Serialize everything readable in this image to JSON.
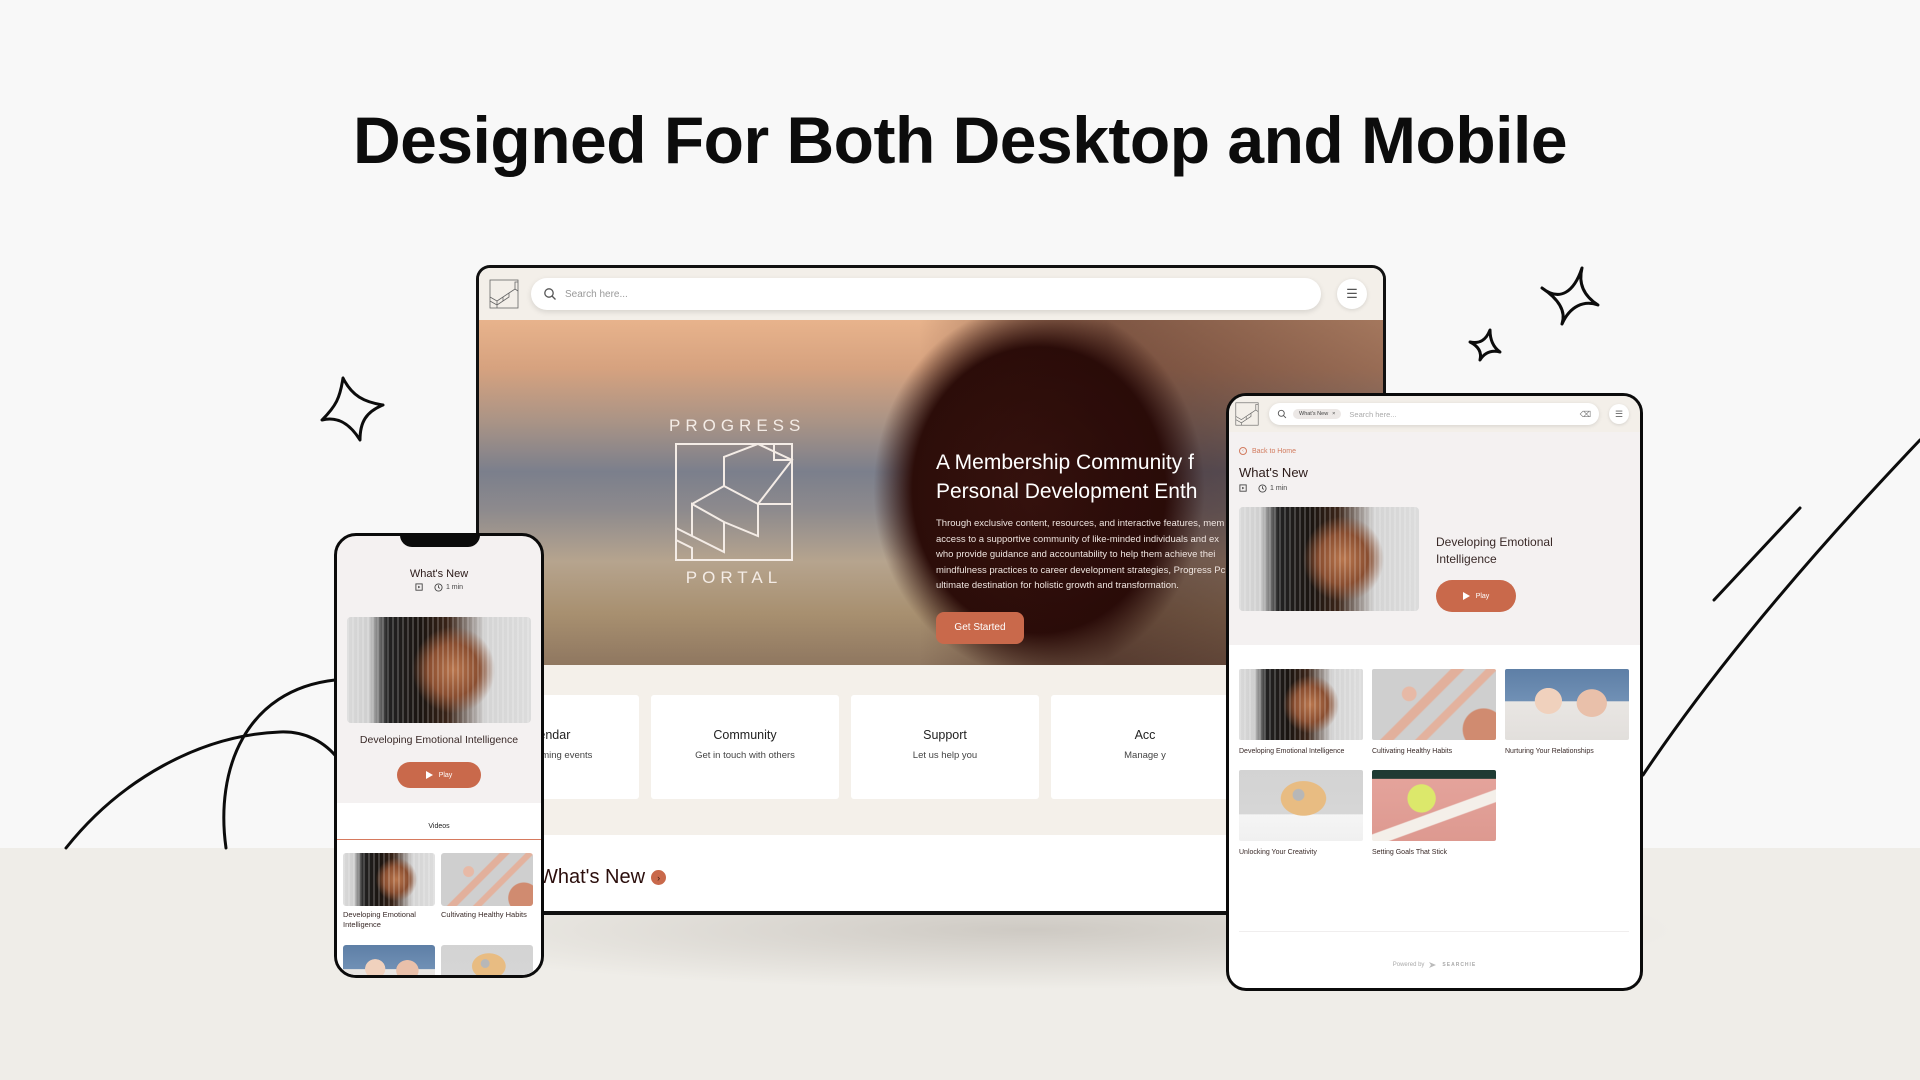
{
  "page": {
    "title": "Designed For Both Desktop and Mobile"
  },
  "colors": {
    "accent": "#c9694b",
    "heading_dark": "#2b0e0c",
    "header_bg": "#f3efe9",
    "background": "#f8f8f8",
    "floor": "#efede8"
  },
  "desktop": {
    "logo_icon": "stairs-logo-icon",
    "search": {
      "placeholder": "Search here...",
      "icon": "search-icon"
    },
    "menu_icon": "hamburger-menu-icon",
    "hero": {
      "brand_top": "PROGRESS",
      "brand_bottom": "PORTAL",
      "title": "A Membership Community f\nPersonal Development Enth",
      "body": "Through exclusive content, resources, and interactive features, mem\naccess to a supportive community of like-minded individuals and ex\nwho provide guidance and accountability to help them achieve thei\nmindfulness practices to career development strategies, Progress Pc\nultimate destination for holistic growth and transformation.",
      "cta": "Get Started"
    },
    "cards": [
      {
        "title": "Calendar",
        "subtitle": "View upcoming events"
      },
      {
        "title": "Community",
        "subtitle": "Get in touch with others"
      },
      {
        "title": "Support",
        "subtitle": "Let us help you"
      },
      {
        "title": "Acc",
        "subtitle": "Manage y"
      }
    ],
    "whats_new": "What's New",
    "whats_new_chevron": "›"
  },
  "phone": {
    "title": "What's New",
    "duration": "1 min",
    "feature_title": "Developing Emotional Intelligence",
    "play": "Play",
    "tab": "Videos",
    "items": [
      {
        "title": "Developing Emotional Intelligence"
      },
      {
        "title": "Cultivating Healthy Habits"
      }
    ]
  },
  "tablet": {
    "search": {
      "chip": "What's New",
      "chip_close": "×",
      "placeholder": "Search here..."
    },
    "back": "Back to Home",
    "title": "What's New",
    "duration": "1 min",
    "feature_title": "Developing Emotional\nIntelligence",
    "play": "Play",
    "items": [
      {
        "title": "Developing Emotional Intelligence"
      },
      {
        "title": "Cultivating Healthy Habits"
      },
      {
        "title": "Nurturing Your Relationships"
      },
      {
        "title": "Unlocking Your Creativity"
      },
      {
        "title": "Setting Goals That Stick"
      }
    ],
    "footer": {
      "powered_by": "Powered by",
      "brand": "SEARCHIE"
    }
  }
}
